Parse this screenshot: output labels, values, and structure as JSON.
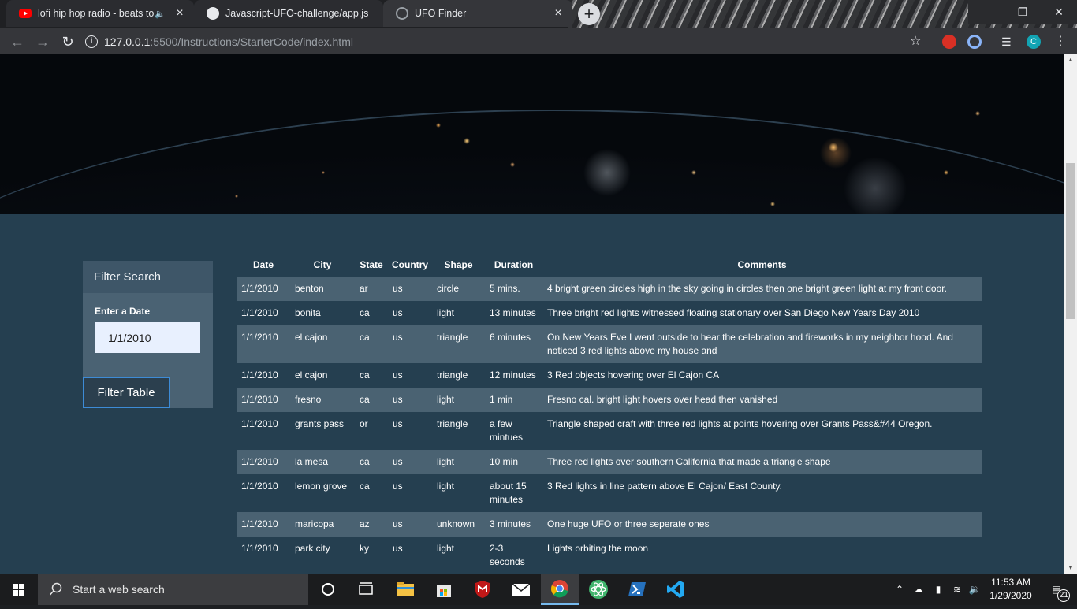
{
  "browser": {
    "tabs": [
      {
        "title": "lofi hip hop radio - beats to r",
        "icon": "youtube-icon",
        "state": "inactive",
        "muted_icon": "speaker-icon"
      },
      {
        "title": "Javascript-UFO-challenge/app.js",
        "icon": "github-icon",
        "state": "inactive"
      },
      {
        "title": "UFO Finder",
        "icon": "globe-icon",
        "state": "active"
      }
    ],
    "url_host": "127.0.0.1",
    "url_rest": ":5500/Instructions/StarterCode/index.html",
    "profile_initial": "C"
  },
  "page": {
    "filter": {
      "heading": "Filter Search",
      "date_label": "Enter a Date",
      "date_value": "1/1/2010",
      "button_label": "Filter Table"
    },
    "table": {
      "headers": [
        "Date",
        "City",
        "State",
        "Country",
        "Shape",
        "Duration",
        "Comments"
      ],
      "rows": [
        [
          "1/1/2010",
          "benton",
          "ar",
          "us",
          "circle",
          "5 mins.",
          "4 bright green circles high in the sky going in circles then one bright green light at my front door."
        ],
        [
          "1/1/2010",
          "bonita",
          "ca",
          "us",
          "light",
          "13 minutes",
          "Three bright red lights witnessed floating stationary over San Diego New Years Day 2010"
        ],
        [
          "1/1/2010",
          "el cajon",
          "ca",
          "us",
          "triangle",
          "6 minutes",
          "On New Years Eve I went outside to hear the celebration and fireworks in my neighbor hood. And noticed 3 red lights above my house and"
        ],
        [
          "1/1/2010",
          "el cajon",
          "ca",
          "us",
          "triangle",
          "12 minutes",
          "3 Red objects hovering over El Cajon CA"
        ],
        [
          "1/1/2010",
          "fresno",
          "ca",
          "us",
          "light",
          "1 min",
          "Fresno cal. bright light hovers over head then vanished"
        ],
        [
          "1/1/2010",
          "grants pass",
          "or",
          "us",
          "triangle",
          "a few mintues",
          "Triangle shaped craft with three red lights at points hovering over Grants Pass&#44 Oregon."
        ],
        [
          "1/1/2010",
          "la mesa",
          "ca",
          "us",
          "light",
          "10 min",
          "Three red lights over southern California that made a triangle shape"
        ],
        [
          "1/1/2010",
          "lemon grove",
          "ca",
          "us",
          "light",
          "about 15 minutes",
          "3 Red lights in line pattern above El Cajon/ East County."
        ],
        [
          "1/1/2010",
          "maricopa",
          "az",
          "us",
          "unknown",
          "3 minutes",
          "One huge UFO or three seperate ones"
        ],
        [
          "1/1/2010",
          "park city",
          "ky",
          "us",
          "light",
          "2-3 seconds",
          "Lights orbiting the moon"
        ],
        [
          "",
          "",
          "",
          "",
          "",
          "",
          ""
        ]
      ]
    }
  },
  "taskbar": {
    "search_placeholder": "Start a web search",
    "apps": [
      "task-view-icon",
      "file-explorer-icon",
      "store-icon",
      "mcafee-icon",
      "mail-icon",
      "chrome-icon",
      "atom-icon",
      "powershell-icon",
      "vscode-icon"
    ],
    "time": "11:53 AM",
    "date": "1/29/2020",
    "notification_count": "21"
  },
  "colors": {
    "page_bg": "#253f50",
    "row_alt": "#4a6272",
    "panel": "#4a6273",
    "button_border": "#3d8bd6",
    "chrome_dark": "#35363a"
  }
}
